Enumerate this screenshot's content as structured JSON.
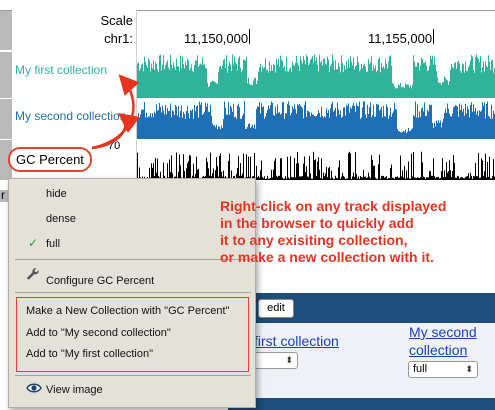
{
  "header": {
    "scale_label": "Scale",
    "chrom_label": "chr1:",
    "coords": [
      "11,150,000",
      "11,155,000"
    ]
  },
  "tracks": [
    {
      "label": "My first collection",
      "color": "#2fb49b"
    },
    {
      "label": "My second collection",
      "color": "#1f6fb5"
    },
    {
      "label": "GC Percent",
      "color": "#000000"
    }
  ],
  "gc_axis_max": "70",
  "context_menu": {
    "items": [
      {
        "label": "hide",
        "checked": false
      },
      {
        "label": "dense",
        "checked": false
      },
      {
        "label": "full",
        "checked": true
      }
    ],
    "configure_label": "Configure GC Percent",
    "collection_items": [
      "Make a New Collection with \"GC Percent\"",
      "Add to \"My second collection\"",
      "Add to \"My first collection\""
    ],
    "view_image_label": "View image",
    "checkmark": "✓"
  },
  "annotation": {
    "lines": [
      "Right-click on any track displayed",
      "in the browser to quickly add",
      "it to any exisiting collection,",
      "or make a new collection with it."
    ],
    "color": "#e8331f"
  },
  "lower_panel": {
    "edit_label": "edit",
    "collections": [
      {
        "name": "first collection",
        "select_value": ""
      },
      {
        "name_line1": "My second",
        "name_line2": "collection",
        "select_value": "full"
      }
    ]
  },
  "stub_text": "r"
}
